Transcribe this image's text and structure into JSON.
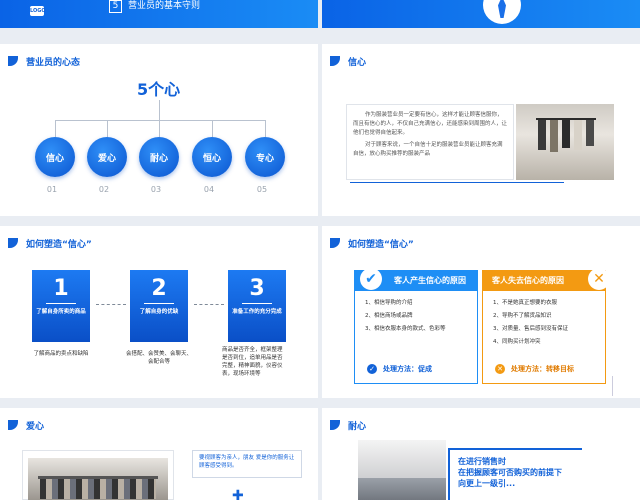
{
  "top_left": {
    "logo_text": "LOGO",
    "number": "5",
    "title": "营业员的基本守则"
  },
  "slide1": {
    "section_title": "营业员的心态",
    "big_title": "5个心",
    "circles": [
      {
        "label": "信心",
        "num": "01"
      },
      {
        "label": "爱心",
        "num": "02"
      },
      {
        "label": "耐心",
        "num": "03"
      },
      {
        "label": "恒心",
        "num": "04"
      },
      {
        "label": "专心",
        "num": "05"
      }
    ]
  },
  "slide2": {
    "section_title": "信心",
    "paragraph1": "作为服装营业员一定要有信心，这样才能让顾客信服你，而且有信心的人，不仅自己充满信心，还能感染到周围的人，让他们也觉得自信起来。",
    "paragraph2": "对于顾客来说，一个自信十足的服装营业员能让顾客充满自信，放心购买推荐的服装产品"
  },
  "slide3": {
    "section_title": "如何塑造“信心”",
    "steps": [
      {
        "num": "1",
        "label": "了解自身所卖的商品",
        "desc": "了解商品的卖点和缺陷"
      },
      {
        "num": "2",
        "label": "了解自身的优缺",
        "desc": "会搭配、会赞美、会聊天、会配合等"
      },
      {
        "num": "3",
        "label": "准备工作的充分完成",
        "desc": "商品是否齐全，框架整理是否到位，追单用品是否完整，精神面貌，仪容仪表，现场环境等"
      }
    ]
  },
  "slide4": {
    "section_title": "如何塑造“信心”",
    "left": {
      "title": "客人产生信心的原因",
      "items": [
        "1、相信导购的介绍",
        "2、相信商场或品牌",
        "3、相信衣服本身的款式、色彩等"
      ],
      "foot": "处理方法：促成",
      "color": "#1e8ef5"
    },
    "right": {
      "title": "客人失去信心的原因",
      "items": [
        "1、不是她真正想要的衣服",
        "2、导购不了解货品知识",
        "3、对质量、售后感到没有保证",
        "4、同购买计划冲突"
      ],
      "foot": "处理方法：转移目标",
      "color": "#f39a12"
    }
  },
  "slide5": {
    "section_title": "爱心",
    "note": "要视顾客为亲人，朋友 爱是你的服务让顾客感受得到。"
  },
  "slide6": {
    "section_title": "耐心",
    "line1": "在进行销售时",
    "line2": "在把握顾客可否购买的前提下",
    "line3": "向更上一级引..."
  }
}
